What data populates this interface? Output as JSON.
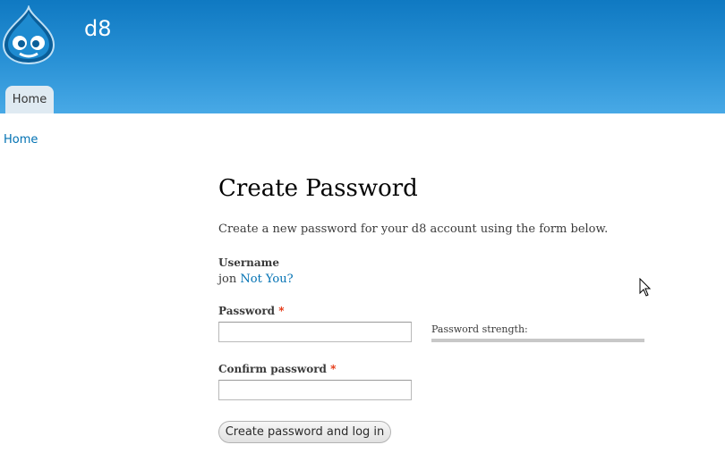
{
  "header": {
    "site_name": "d8",
    "logo": "drupal-drop-logo",
    "colors": {
      "gradient_top": "#0f79c2",
      "gradient_bottom": "#48a9e6"
    }
  },
  "nav": {
    "tabs": [
      {
        "label": "Home",
        "active": true
      }
    ]
  },
  "breadcrumb": {
    "items": [
      "Home"
    ]
  },
  "main": {
    "title": "Create Password",
    "intro": "Create a new password for your d8 account using the form below.",
    "username": {
      "label": "Username",
      "value": "jon",
      "not_you_link": "Not You?"
    },
    "password": {
      "label": "Password",
      "required_marker": "*",
      "value": ""
    },
    "password_strength": {
      "label": "Password strength:",
      "level": 0
    },
    "confirm": {
      "label": "Confirm password",
      "required_marker": "*",
      "value": ""
    },
    "submit_label": "Create password and log in"
  },
  "colors": {
    "link": "#0071b3",
    "required": "#e32700"
  }
}
